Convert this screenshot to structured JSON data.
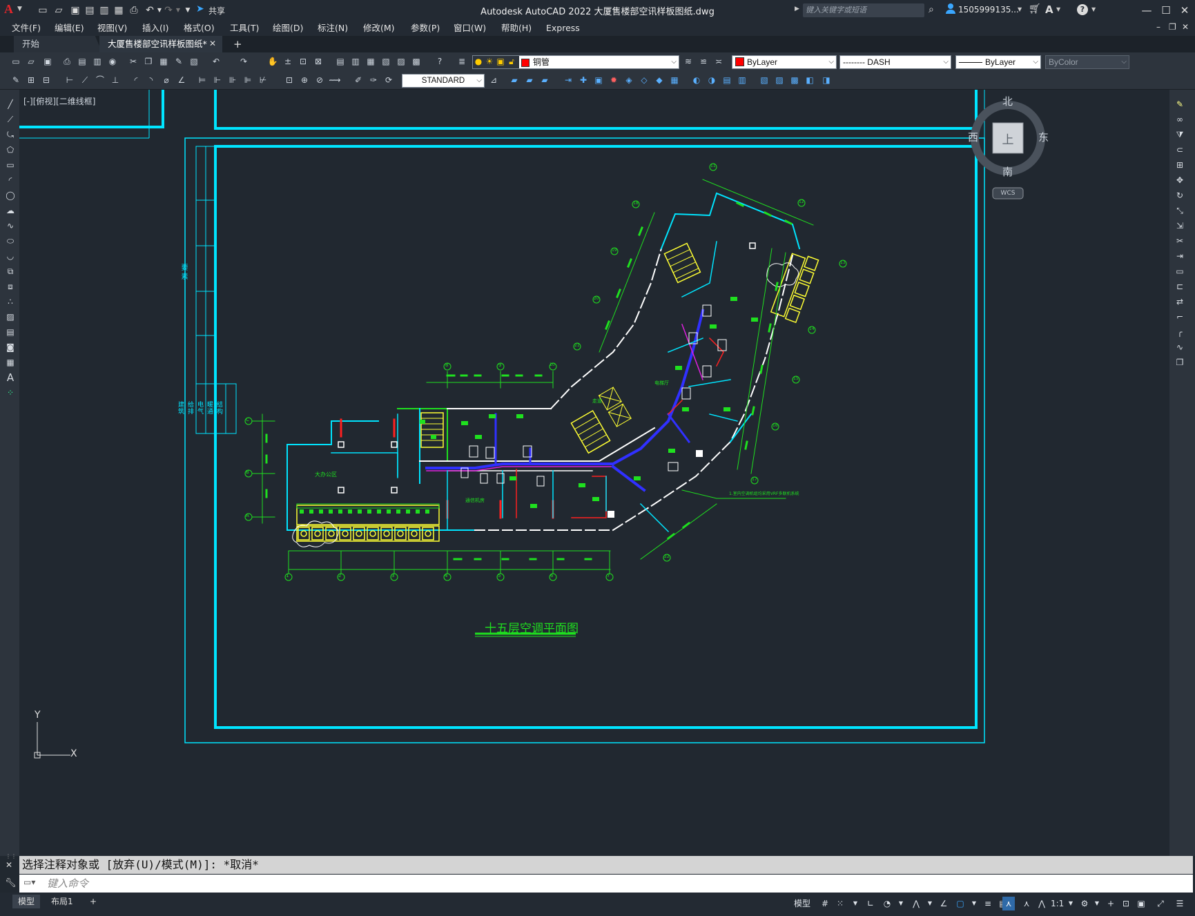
{
  "app": {
    "title": "Autodesk AutoCAD 2022    大厦售楼部空讯样板图纸.dwg",
    "logo": "A",
    "share_label": "共享",
    "search_placeholder": "键入关键字或短语",
    "user": "1505999135...",
    "help": "?"
  },
  "menu": [
    "文件(F)",
    "编辑(E)",
    "视图(V)",
    "插入(I)",
    "格式(O)",
    "工具(T)",
    "绘图(D)",
    "标注(N)",
    "修改(M)",
    "参数(P)",
    "窗口(W)",
    "帮助(H)",
    "Express"
  ],
  "tabs": [
    {
      "label": "开始",
      "active": false
    },
    {
      "label": "大厦售楼部空讯样板图纸*",
      "active": true
    }
  ],
  "add_tab": "+",
  "toolbar": {
    "layer_value": "铜管",
    "color_value": "ByLayer",
    "linetype_value": "-------- DASH",
    "lineweight_value": "ByLayer",
    "plotstyle_value": "ByColor",
    "textstyle_value": "STANDARD"
  },
  "viewport": {
    "label": "[-][俯视][二维线框]",
    "drawing_title": "十五层空调平面图",
    "ucs_x": "X",
    "ucs_y": "Y",
    "compass": {
      "north": "北",
      "south": "南",
      "east": "东",
      "west": "西",
      "top": "上",
      "wcs": "WCS"
    },
    "side_text": "要 素",
    "side_columns": [
      "建",
      "给",
      "电",
      "暖",
      "结"
    ],
    "side_columns2": [
      "筑",
      "排",
      "气",
      "通",
      "构"
    ],
    "room_labels": [
      "大办公区",
      "通信机房",
      "走道",
      "电梯厅"
    ],
    "note": "1.室内空调机组均采用VRF多联机系统"
  },
  "grid_bottom": [
    "1",
    "2",
    "3",
    "4",
    "5",
    "6",
    "7"
  ],
  "grid_left": [
    "C",
    "B",
    "A"
  ],
  "grid_top": [
    "8",
    "9",
    "10"
  ],
  "grid_right": [
    "11",
    "12",
    "13",
    "14",
    "15",
    "16",
    "17",
    "18",
    "19",
    "20",
    "21",
    "22",
    "23"
  ],
  "command": {
    "history": "选择注释对象或 [放弃(U)/模式(M)]: *取消*",
    "input_placeholder": "键入命令"
  },
  "layout_tabs": [
    "模型",
    "布局1",
    "+"
  ],
  "status": {
    "model_label": "模型",
    "scale": "1:1"
  },
  "colors": {
    "cyan": "#00e5ff",
    "green": "#1fe01f",
    "yellow": "#ffff33",
    "red": "#ff2020",
    "blue": "#3030ff",
    "magenta": "#e020e0",
    "white": "#ffffff"
  }
}
